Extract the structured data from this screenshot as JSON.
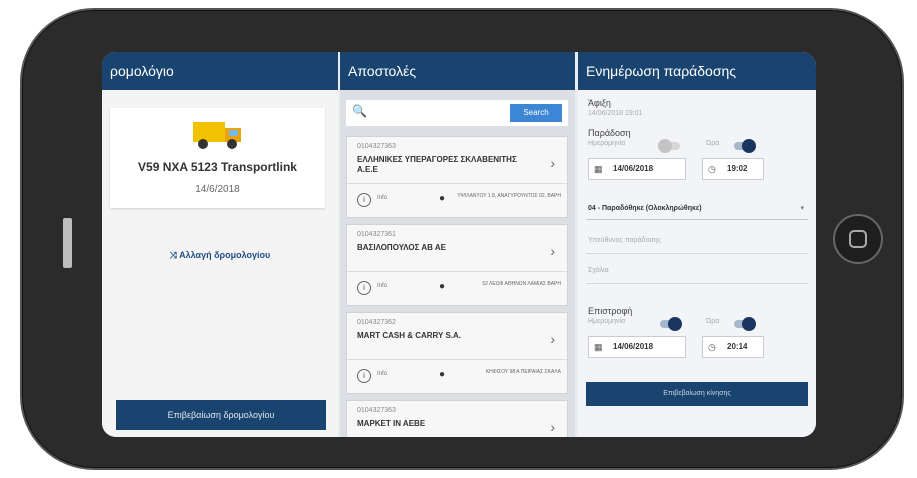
{
  "column1": {
    "header": "ρομολόγιο",
    "route_title": "V59 NXA 5123 Transportlink",
    "route_date": "14/6/2018",
    "change_route": "⤨ Αλλαγή δρομολογίου",
    "confirm_button": "Επιβεβαίωση δρομολογίου"
  },
  "column2": {
    "header": "Αποστολές",
    "search_icon": "search-icon",
    "search_button": "Search",
    "shipments": [
      {
        "code": "0104327363",
        "name": "ΕΛΛΗΝΙΚΕΣ ΥΠΕΡΑΓΟΡΕΣ ΣΚΛΑΒΕΝΙΤΗΣ Α.Ε.Ε",
        "info": "Info",
        "address": "ΥΨΙΛΑΝΤΟΥ 1 8, ΑΝΑΓΥΡΟΥΝΤΟΣ 02, ΒΑΡΗ"
      },
      {
        "code": "0104327361",
        "name": "ΒΑΣΙΛΟΠΟΥΛΟΣ ΑΒ ΑΕ",
        "info": "Info",
        "address": "52 ΛΕΩΦ ΑΘΗΝΩΝ ΛΑΜΙΑΣ ΒΑΡΗ"
      },
      {
        "code": "0104327362",
        "name": "MART CASH & CARRY S.A.",
        "info": "Info",
        "address": "ΚΗΦΙΣΟΥ 98 Α ΠΕΙΡΑΙΑΣ ΣΚΑΛΑ"
      },
      {
        "code": "0104327363",
        "name": "ΜΑΡΚΕΤ ΙΝ ΑΕΒΕ",
        "info": "",
        "address": ""
      }
    ]
  },
  "column3": {
    "header": "Ενημέρωση παράδοσης",
    "arrival_label": "Άφιξη",
    "arrival_value": "14/06/2018 19:01",
    "delivery_label": "Παράδοση",
    "date_label": "Ημερομηνία",
    "time_label": "Ώρα",
    "delivery_date": "14/06/2018",
    "delivery_time": "19:02",
    "status_value": "04 - Παραδόθηκε (Ολοκληρώθηκε)",
    "responsible_placeholder": "Υπεύθυνος παράδοσης",
    "notes_placeholder": "Σχόλια",
    "return_label": "Επιστροφή",
    "return_date": "14/06/2018",
    "return_time": "20:14",
    "confirm_button": "Επιβεβαίωση κίνησης"
  },
  "colors": {
    "header": "#1a4470",
    "accent": "#3d86d6",
    "truck": "#f2c200"
  }
}
